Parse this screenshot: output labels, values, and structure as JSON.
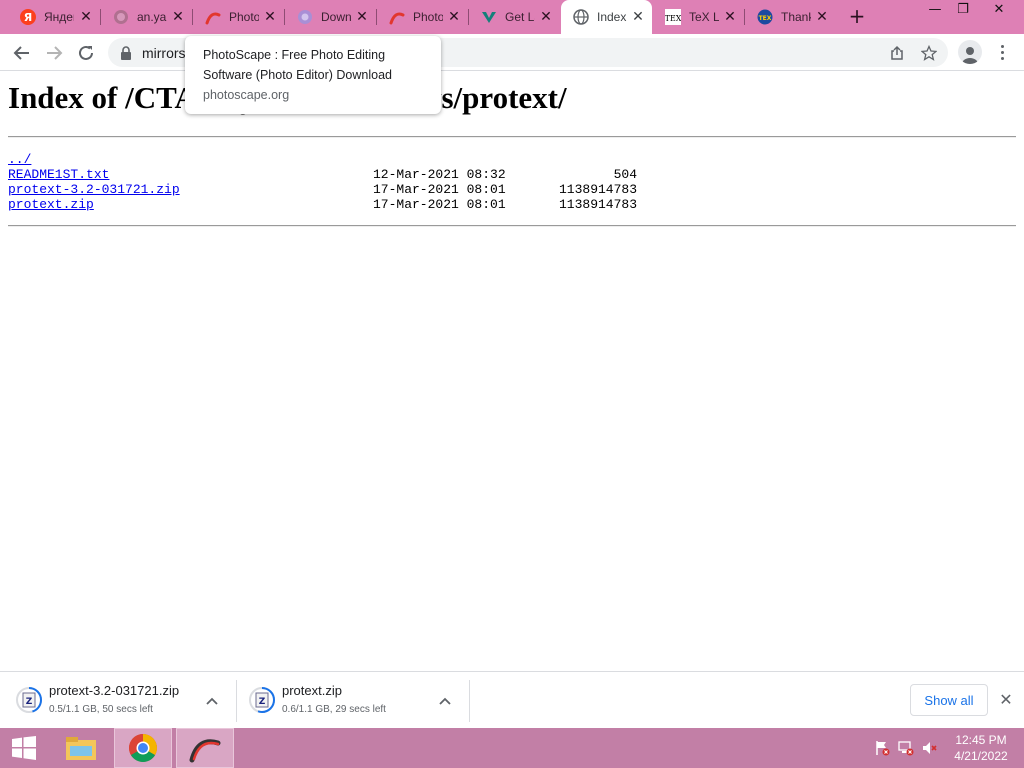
{
  "browser": {
    "tabs": [
      {
        "label": "Яндекс",
        "icon": "yandex-icon",
        "active": false
      },
      {
        "label": "an.yandex",
        "icon": "globe-gray-icon",
        "active": false
      },
      {
        "label": "PhotoScape",
        "icon": "photoscape-icon",
        "active": false
      },
      {
        "label": "Download",
        "icon": "download-site-icon",
        "active": false
      },
      {
        "label": "PhotoScape",
        "icon": "photoscape-icon",
        "active": false
      },
      {
        "label": "Get LaTeX",
        "icon": "latex-project-icon",
        "active": false
      },
      {
        "label": "Index of",
        "icon": "globe-icon",
        "active": true
      },
      {
        "label": "TeX Live",
        "icon": "tex-icon",
        "active": false
      },
      {
        "label": "Thanks",
        "icon": "tex-users-group-icon",
        "active": false
      }
    ],
    "url": "mirrors.ctan.org/systems/windows/protext/",
    "tooltip": {
      "title": "PhotoScape : Free Photo Editing Software (Photo Editor) Download",
      "url": "photoscape.org"
    }
  },
  "page": {
    "heading": "Index of /CTAN/systems/windows/protext/",
    "parent_link": "../",
    "files": [
      {
        "name": "README1ST.txt",
        "date": "12-Mar-2021 08:32",
        "size": "504"
      },
      {
        "name": "protext-3.2-031721.zip",
        "date": "17-Mar-2021 08:01",
        "size": "1138914783"
      },
      {
        "name": "protext.zip",
        "date": "17-Mar-2021 08:01",
        "size": "1138914783"
      }
    ]
  },
  "downloads": {
    "items": [
      {
        "name": "protext-3.2-031721.zip",
        "status": "0.5/1.1 GB, 50 secs left",
        "progress": 0.45
      },
      {
        "name": "protext.zip",
        "status": "0.6/1.1 GB, 29 secs left",
        "progress": 0.55
      }
    ],
    "show_all_label": "Show all"
  },
  "taskbar": {
    "time": "12:45 PM",
    "date": "4/21/2022"
  },
  "colors": {
    "tabstrip": "#de80b5",
    "taskbar": "#c27fa6",
    "link": "#0000ee",
    "accent": "#1a73e8"
  }
}
